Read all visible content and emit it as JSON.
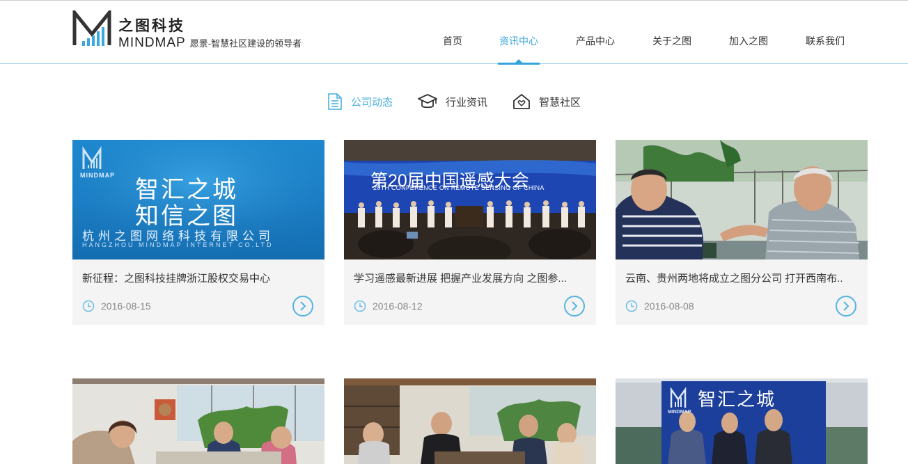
{
  "brand": {
    "cn": "之图科技",
    "en": "MINDMAP",
    "slogan": "愿景-智慧社区建设的领导者"
  },
  "nav": [
    {
      "label": "首页",
      "active": false
    },
    {
      "label": "资讯中心",
      "active": true
    },
    {
      "label": "产品中心",
      "active": false
    },
    {
      "label": "关于之图",
      "active": false
    },
    {
      "label": "加入之图",
      "active": false
    },
    {
      "label": "联系我们",
      "active": false
    }
  ],
  "subtabs": [
    {
      "label": "公司动态",
      "icon": "document-icon",
      "active": true
    },
    {
      "label": "行业资讯",
      "icon": "graduation-cap-icon",
      "active": false
    },
    {
      "label": "智慧社区",
      "icon": "home-heart-icon",
      "active": false
    }
  ],
  "cards": [
    {
      "title": "新征程：之图科技挂牌浙江股权交易中心",
      "date": "2016-08-15",
      "image": {
        "logo_text": "MINDMAP",
        "line1": "智汇之城",
        "line2": "知信之图",
        "company_cn": "杭州之图网络科技有限公司",
        "company_en": "HANGZHOU MINDMAP INTERNET CO.LTD"
      }
    },
    {
      "title": "学习遥感最新进展 把握产业发展方向 之图参...",
      "date": "2016-08-12",
      "image": {
        "banner_cn": "第20届中国遥感大会",
        "banner_en": "20TH CONFERENCE ON REMOTE SENSING OF CHINA"
      }
    },
    {
      "title": "云南、贵州两地将成立之图分公司 打开西南布..",
      "date": "2016-08-08",
      "image": {}
    }
  ],
  "row2": [
    {
      "image": "meeting-room-photo"
    },
    {
      "image": "office-meeting-photo"
    },
    {
      "image": "team-photo-with-logo-wall",
      "logo_text": "MINDMAP",
      "wall_text": "智汇之城"
    }
  ],
  "colors": {
    "accent": "#35a4dc",
    "card_bg": "#f4f4f4",
    "header_border": "#9fd3ea"
  }
}
